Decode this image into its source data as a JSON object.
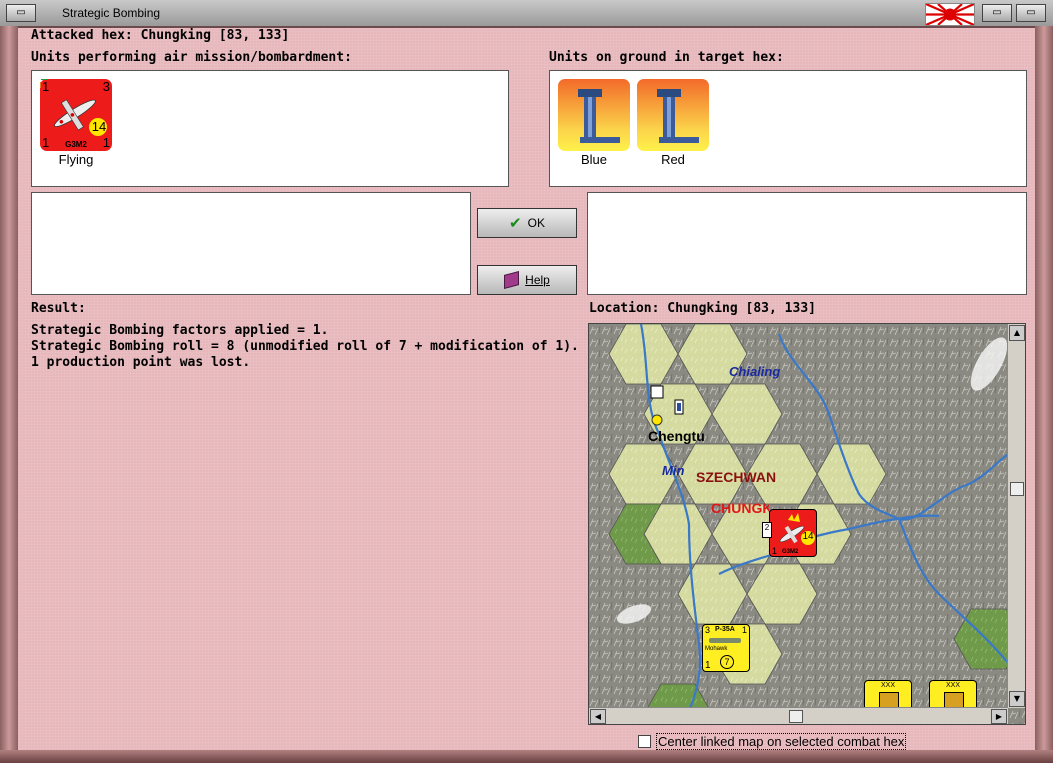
{
  "window": {
    "title": "Strategic Bombing"
  },
  "attacked_hex": "Attacked hex: Chungking  [83, 133]",
  "air_units": {
    "label": "Units performing air mission/bombardment:",
    "units": [
      {
        "name": "G3M2",
        "top_left": "1",
        "top_right": "3",
        "factor": "14",
        "bottom_left": "1",
        "bottom_right": "1",
        "status": "Flying",
        "color": "#ee1b1b"
      }
    ]
  },
  "ground_units": {
    "label": "Units on ground in target hex:",
    "units": [
      {
        "icon": "factory-icon",
        "caption": "Blue"
      },
      {
        "icon": "factory-icon",
        "caption": "Red"
      }
    ]
  },
  "buttons": {
    "ok": "OK",
    "help": "Help"
  },
  "result": {
    "label": "Result:",
    "lines": [
      "Strategic Bombing factors applied = 1.",
      "Strategic Bombing roll = 8 (unmodified roll of 7 + modification of 1).",
      "1 production point was lost."
    ]
  },
  "location": {
    "label": "Location:  Chungking  [83, 133]"
  },
  "map": {
    "labels": {
      "chialing": "Chialing",
      "chengtu": "Chengtu",
      "min": "Min",
      "szechwan": "SZECHWAN",
      "chungking": "CHUNGKING"
    },
    "bomber": {
      "factor": "14",
      "name": "G3M2",
      "bottom_left": "1",
      "side_value": "2"
    },
    "fighter": {
      "name": "P-35A",
      "type": "Mohawk",
      "top_left": "3",
      "top_right": "1",
      "bottom_left": "1",
      "factor": "7"
    },
    "corps": [
      {
        "size": "XXX"
      },
      {
        "size": "XXX"
      }
    ]
  },
  "checkbox": {
    "label": "Center linked map on selected combat hex",
    "checked": false
  },
  "colors": {
    "window_bg": "#e6b8bc",
    "air_unit": "#ee1b1b",
    "fighter": "#ffee22",
    "plains": "#d6dca0",
    "mountains": "#8a8a80"
  }
}
